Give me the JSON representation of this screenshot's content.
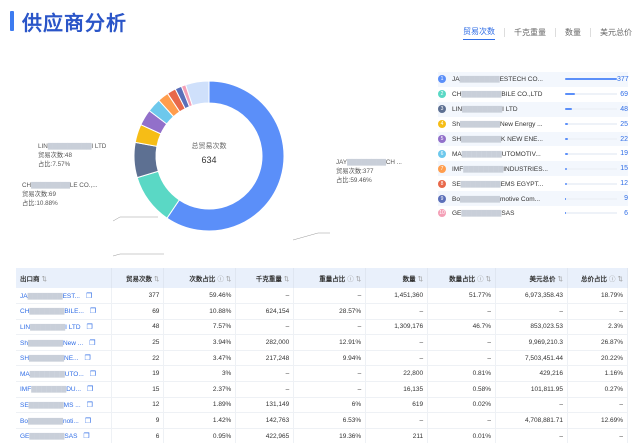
{
  "header": {
    "title": "供应商分析"
  },
  "tabs": [
    {
      "label": "贸易次数",
      "active": true
    },
    {
      "label": "千克重量",
      "active": false
    },
    {
      "label": "数量",
      "active": false
    },
    {
      "label": "美元总价",
      "active": false
    }
  ],
  "donut": {
    "center_label": "总贸易次数",
    "center_value": "634",
    "callouts": [
      {
        "name_left": "LIN",
        "name_right": "I LTD",
        "count": "贸易次数:48",
        "pct": "占比:7.57%"
      },
      {
        "name_left": "CH",
        "name_right": "LE CO.,...",
        "count": "贸易次数:69",
        "pct": "占比:10.88%"
      },
      {
        "name_left": "JAY",
        "name_right": "CH ...",
        "count": "贸易次数:377",
        "pct": "占比:59.46%"
      }
    ]
  },
  "legend": [
    {
      "badge": "1",
      "color": "#5b8ff9",
      "name_left": "JA",
      "name_right": "ESTECH CO...",
      "value": "377",
      "fraction": 1.0
    },
    {
      "badge": "2",
      "color": "#5ad8c5",
      "name_left": "CH",
      "name_right": "BILE CO.,LTD",
      "value": "69",
      "fraction": 0.183
    },
    {
      "badge": "3",
      "color": "#5d7092",
      "name_left": "LIN",
      "name_right": "I LTD",
      "value": "48",
      "fraction": 0.127
    },
    {
      "badge": "4",
      "color": "#f6bd16",
      "name_left": "Sh",
      "name_right": "New Energy ...",
      "value": "25",
      "fraction": 0.066
    },
    {
      "badge": "5",
      "color": "#9270ca",
      "name_left": "SH",
      "name_right": "K NEW ENE...",
      "value": "22",
      "fraction": 0.058
    },
    {
      "badge": "6",
      "color": "#6dc8ec",
      "name_left": "MA",
      "name_right": "UTOMOTIV...",
      "value": "19",
      "fraction": 0.05
    },
    {
      "badge": "7",
      "color": "#ff9d4d",
      "name_left": "IMF",
      "name_right": "INDUSTRIES...",
      "value": "15",
      "fraction": 0.04
    },
    {
      "badge": "8",
      "color": "#e8684a",
      "name_left": "SE",
      "name_right": "EMS EGYPT...",
      "value": "12",
      "fraction": 0.032
    },
    {
      "badge": "9",
      "color": "#5b6fb9",
      "name_left": "Bo",
      "name_right": "motive Com...",
      "value": "9",
      "fraction": 0.024
    },
    {
      "badge": "10",
      "color": "#f49fb6",
      "name_left": "GE",
      "name_right": "SAS",
      "value": "6",
      "fraction": 0.016
    }
  ],
  "table": {
    "headers": [
      "出口商",
      "贸易次数",
      "次数占比",
      "千克重量",
      "重量占比",
      "数量",
      "数量占比",
      "美元总价",
      "总价占比"
    ],
    "rows": [
      {
        "exporter_left": "JA",
        "exporter_right": "EST...",
        "c": [
          "377",
          "59.46%",
          "–",
          "–",
          "1,451,360",
          "51.77%",
          "6,973,358.43",
          "18.79%"
        ]
      },
      {
        "exporter_left": "CH",
        "exporter_right": "BILE...",
        "c": [
          "69",
          "10.88%",
          "624,154",
          "28.57%",
          "–",
          "–",
          "–",
          "–"
        ]
      },
      {
        "exporter_left": "LIN",
        "exporter_right": "I LTD",
        "c": [
          "48",
          "7.57%",
          "–",
          "–",
          "1,309,176",
          "46.7%",
          "853,023.53",
          "2.3%"
        ]
      },
      {
        "exporter_left": "Sh",
        "exporter_right": "New ...",
        "c": [
          "25",
          "3.94%",
          "282,000",
          "12.91%",
          "–",
          "–",
          "9,969,210.3",
          "26.87%"
        ]
      },
      {
        "exporter_left": "SH",
        "exporter_right": "NE...",
        "c": [
          "22",
          "3.47%",
          "217,248",
          "9.94%",
          "–",
          "–",
          "7,503,451.44",
          "20.22%"
        ]
      },
      {
        "exporter_left": "MA",
        "exporter_right": "UTO...",
        "c": [
          "19",
          "3%",
          "–",
          "–",
          "22,800",
          "0.81%",
          "429,216",
          "1.16%"
        ]
      },
      {
        "exporter_left": "IMF",
        "exporter_right": "DU...",
        "c": [
          "15",
          "2.37%",
          "–",
          "–",
          "16,135",
          "0.58%",
          "101,811.95",
          "0.27%"
        ]
      },
      {
        "exporter_left": "SE",
        "exporter_right": "MS ...",
        "c": [
          "12",
          "1.89%",
          "131,149",
          "6%",
          "619",
          "0.02%",
          "–",
          "–"
        ]
      },
      {
        "exporter_left": "Bo",
        "exporter_right": "noti...",
        "c": [
          "9",
          "1.42%",
          "142,763",
          "6.53%",
          "–",
          "–",
          "4,708,881.71",
          "12.69%"
        ]
      },
      {
        "exporter_left": "GE",
        "exporter_right": "SAS",
        "c": [
          "6",
          "0.95%",
          "422,965",
          "19.36%",
          "211",
          "0.01%",
          "–",
          "–"
        ]
      }
    ]
  }
}
